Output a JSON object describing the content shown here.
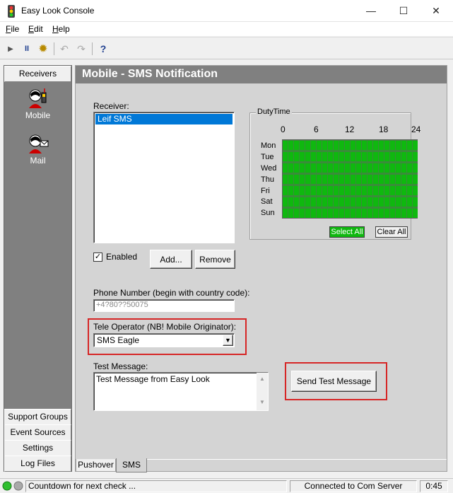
{
  "window": {
    "title": "Easy Look Console",
    "minimize": "—",
    "maximize": "☐",
    "close": "✕"
  },
  "menu": [
    {
      "label": "File",
      "accel": "F",
      "rest": "ile"
    },
    {
      "label": "Edit",
      "accel": "E",
      "rest": "dit"
    },
    {
      "label": "Help",
      "accel": "H",
      "rest": "elp"
    }
  ],
  "toolbar": {
    "play": "▶",
    "pause": "II",
    "settings": "✹",
    "undo": "↶",
    "redo": "↷",
    "help": "?"
  },
  "leftbar": {
    "top_header": "Receivers",
    "items": [
      {
        "label": "Mobile"
      },
      {
        "label": "Mail"
      }
    ],
    "bottom_headers": [
      "Support Groups",
      "Event Sources",
      "Settings",
      "Log Files"
    ]
  },
  "main": {
    "title": "Mobile - SMS Notification",
    "receiver_label": "Receiver:",
    "receivers": [
      {
        "name": "Leif SMS",
        "selected": true
      }
    ],
    "enabled_label": "Enabled",
    "enabled_checked": true,
    "add_button": "Add...",
    "remove_button": "Remove",
    "phone_label": "Phone Number (begin with country code):",
    "phone_value": "+4?80??50075",
    "operator_label": "Tele Operator (NB! Mobile Originator):",
    "operator_value": "SMS Eagle",
    "test_message_label": "Test Message:",
    "test_message_value": "Test Message from Easy Look",
    "send_test_button": "Send Test Message",
    "dutytime": {
      "legend": "DutyTime",
      "hours": [
        "0",
        "6",
        "12",
        "18",
        "24"
      ],
      "days": [
        "Mon",
        "Tue",
        "Wed",
        "Thu",
        "Fri",
        "Sat",
        "Sun"
      ],
      "select_all": "Select All",
      "clear_all": "Clear All"
    },
    "tabs": [
      {
        "label": "Pushover",
        "active": false
      },
      {
        "label": "SMS",
        "active": true
      }
    ]
  },
  "statusbar": {
    "countdown": "Countdown for next check ...",
    "connection": "Connected to Com Server",
    "time": "0:45"
  },
  "colors": {
    "grid_on": "#0fb80f",
    "highlight": "#d62626",
    "selection": "#0078d7"
  }
}
